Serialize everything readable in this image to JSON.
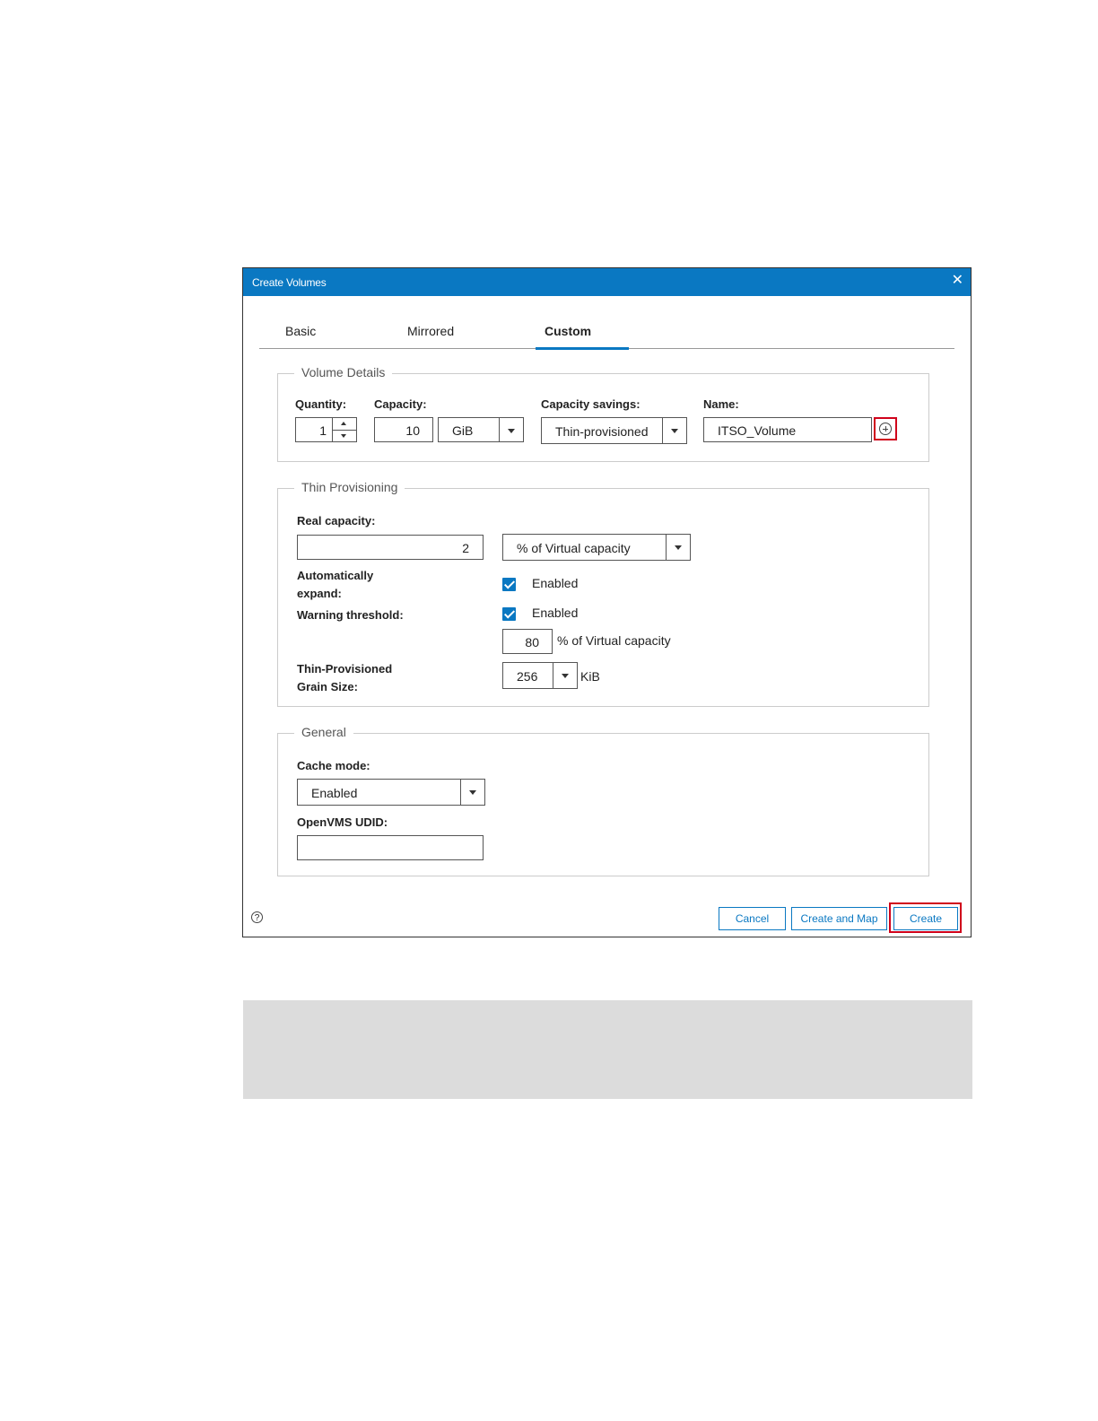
{
  "dialog": {
    "title": "Create Volumes",
    "close_icon": "close-icon"
  },
  "tabs": [
    {
      "label": "Basic"
    },
    {
      "label": "Mirrored"
    },
    {
      "label": "Custom"
    }
  ],
  "volume_details": {
    "legend": "Volume Details",
    "quantity_label": "Quantity:",
    "quantity_value": "1",
    "capacity_label": "Capacity:",
    "capacity_value": "10",
    "capacity_unit": "GiB",
    "savings_label": "Capacity savings:",
    "savings_value": "Thin-provisioned",
    "name_label": "Name:",
    "name_value": "ITSO_Volume",
    "add_icon": "add-circle-icon"
  },
  "thin_provisioning": {
    "legend": "Thin Provisioning",
    "real_capacity_label": "Real capacity:",
    "real_capacity_value": "2",
    "real_capacity_unit": "% of Virtual capacity",
    "auto_expand_label_line1": "Automatically",
    "auto_expand_label_line2": "expand:",
    "auto_expand_text": "Enabled",
    "auto_expand_checked": true,
    "warning_label": "Warning threshold:",
    "warning_text": "Enabled",
    "warning_checked": true,
    "warning_value": "80",
    "warning_unit": "% of Virtual capacity",
    "grain_label_line1": "Thin-Provisioned",
    "grain_label_line2": "Grain Size:",
    "grain_value": "256",
    "grain_unit": "KiB"
  },
  "general": {
    "legend": "General",
    "cache_label": "Cache mode:",
    "cache_value": "Enabled",
    "udid_label": "OpenVMS UDID:",
    "udid_value": ""
  },
  "footer": {
    "help_icon": "help-icon",
    "cancel_label": "Cancel",
    "create_and_map_label": "Create and Map",
    "create_label": "Create"
  },
  "colors": {
    "accent": "#0a78c2",
    "highlight": "#d0021b"
  }
}
